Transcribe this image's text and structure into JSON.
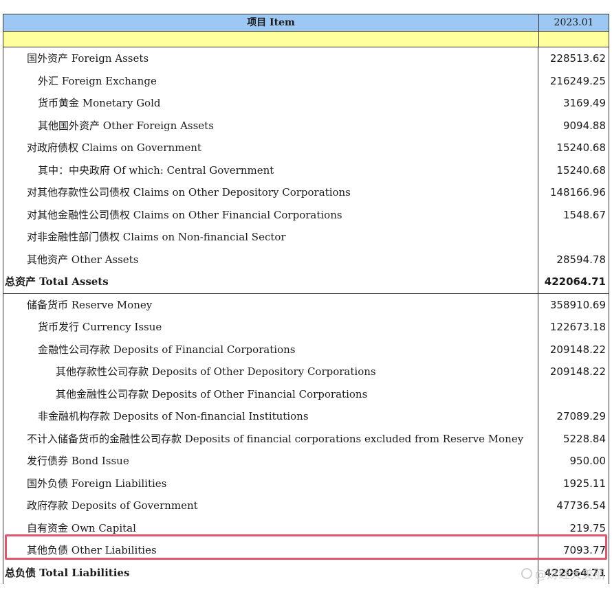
{
  "header": {
    "item_label": "项目 Item",
    "period_label": "2023.01"
  },
  "assets": [
    {
      "label": "国外资产 Foreign Assets",
      "value": "228513.62",
      "level": 1
    },
    {
      "label": "外汇 Foreign Exchange",
      "value": "216249.25",
      "level": 2
    },
    {
      "label": "货币黄金 Monetary Gold",
      "value": "3169.49",
      "level": 2
    },
    {
      "label": "其他国外资产 Other Foreign Assets",
      "value": "9094.88",
      "level": 2
    },
    {
      "label": "对政府债权 Claims on Government",
      "value": "15240.68",
      "level": 1
    },
    {
      "label": "其中：中央政府 Of which: Central Government",
      "value": "15240.68",
      "level": 2
    },
    {
      "label": "对其他存款性公司债权 Claims on Other Depository Corporations",
      "value": "148166.96",
      "level": 1
    },
    {
      "label": "对其他金融性公司债权 Claims on Other Financial Corporations",
      "value": "1548.67",
      "level": 1
    },
    {
      "label": "对非金融性部门债权 Claims on Non-financial Sector",
      "value": "",
      "level": 1
    },
    {
      "label": "其他资产 Other Assets",
      "value": "28594.78",
      "level": 1
    }
  ],
  "total_assets": {
    "label": "总资产 Total Assets",
    "value": "422064.71"
  },
  "liabilities": [
    {
      "label": "储备货币 Reserve Money",
      "value": "358910.69",
      "level": 1
    },
    {
      "label": "货币发行 Currency Issue",
      "value": "122673.18",
      "level": 2
    },
    {
      "label": "金融性公司存款 Deposits of Financial Corporations",
      "value": "209148.22",
      "level": 2
    },
    {
      "label": "其他存款性公司存款 Deposits of Other Depository Corporations",
      "value": "209148.22",
      "level": 3
    },
    {
      "label": "其他金融性公司存款 Deposits of Other Financial Corporations",
      "value": "",
      "level": 3
    },
    {
      "label": "非金融机构存款 Deposits of Non-financial Institutions",
      "value": "27089.29",
      "level": 2
    },
    {
      "label": "不计入储备货币的金融性公司存款 Deposits of financial corporations excluded from Reserve Money",
      "value": "5228.84",
      "level": 1
    },
    {
      "label": "发行债券 Bond Issue",
      "value": "950.00",
      "level": 1
    },
    {
      "label": "国外负债 Foreign Liabilities",
      "value": "1925.11",
      "level": 1
    },
    {
      "label": "政府存款 Deposits of Government",
      "value": "47736.54",
      "level": 1
    },
    {
      "label": "自有资金 Own Capital",
      "value": "219.75",
      "level": 1
    },
    {
      "label": "其他负债 Other Liabilities",
      "value": "7093.77",
      "level": 1
    }
  ],
  "total_liabilities": {
    "label": "总负债 Total Liabilities",
    "value": "422064.71"
  },
  "watermark": "@财经大美丽",
  "colors": {
    "header_bg": "#9cc8f3",
    "subheader_bg": "#ffff9e",
    "highlight": "#e0566c"
  }
}
